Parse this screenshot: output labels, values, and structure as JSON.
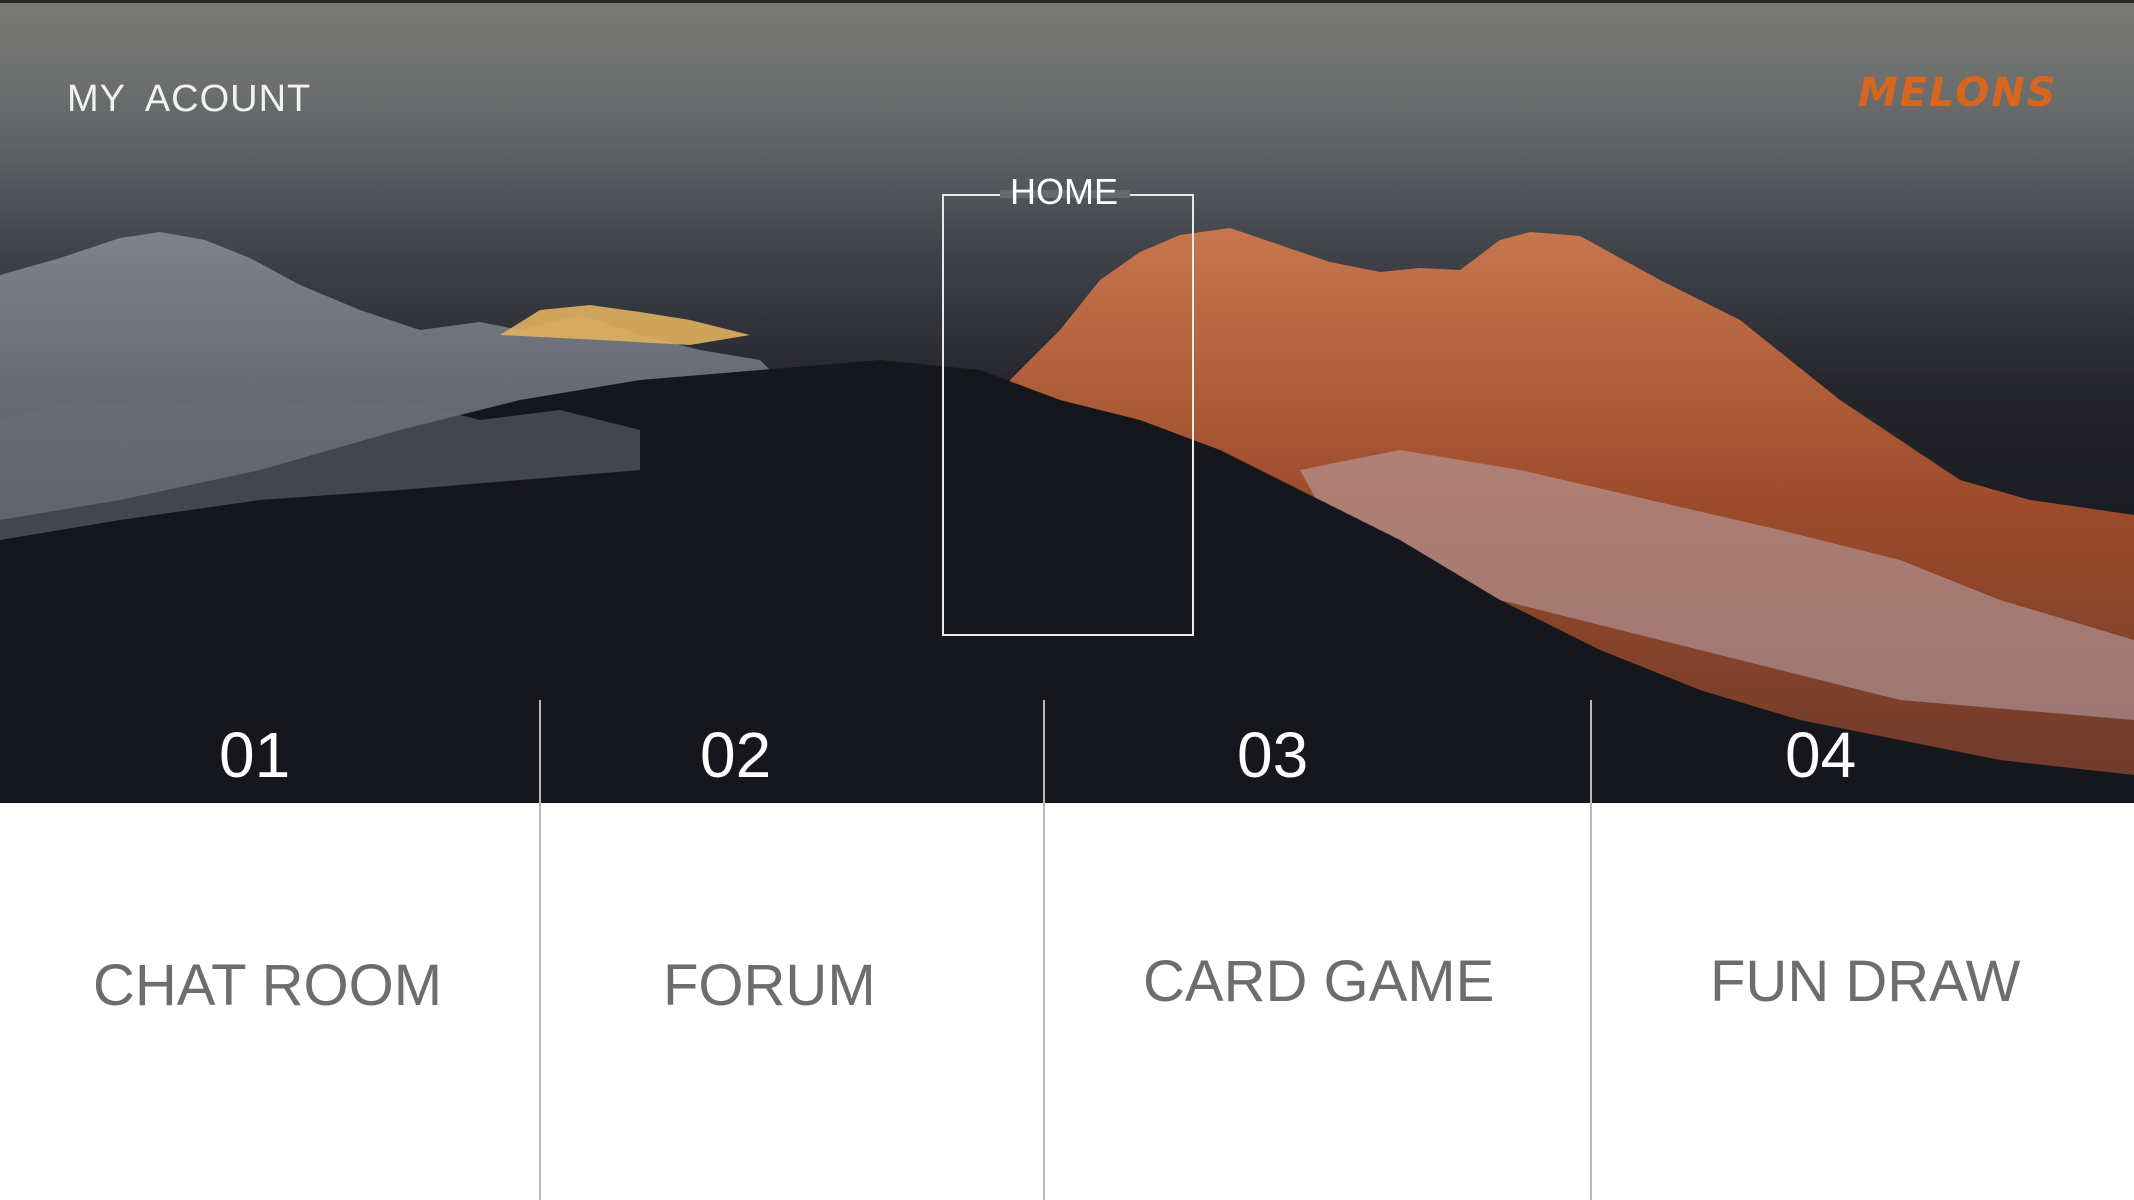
{
  "header": {
    "account_label": "MY  ACOUNT",
    "logo_text": "MELONS",
    "home_label": "HOME"
  },
  "accent_color": "#d9661f",
  "sections": [
    {
      "number": "01",
      "label": "CHAT ROOM"
    },
    {
      "number": "02",
      "label": "FORUM"
    },
    {
      "number": "03",
      "label": "CARD GAME"
    },
    {
      "number": "04",
      "label": "FUN DRAW"
    }
  ]
}
